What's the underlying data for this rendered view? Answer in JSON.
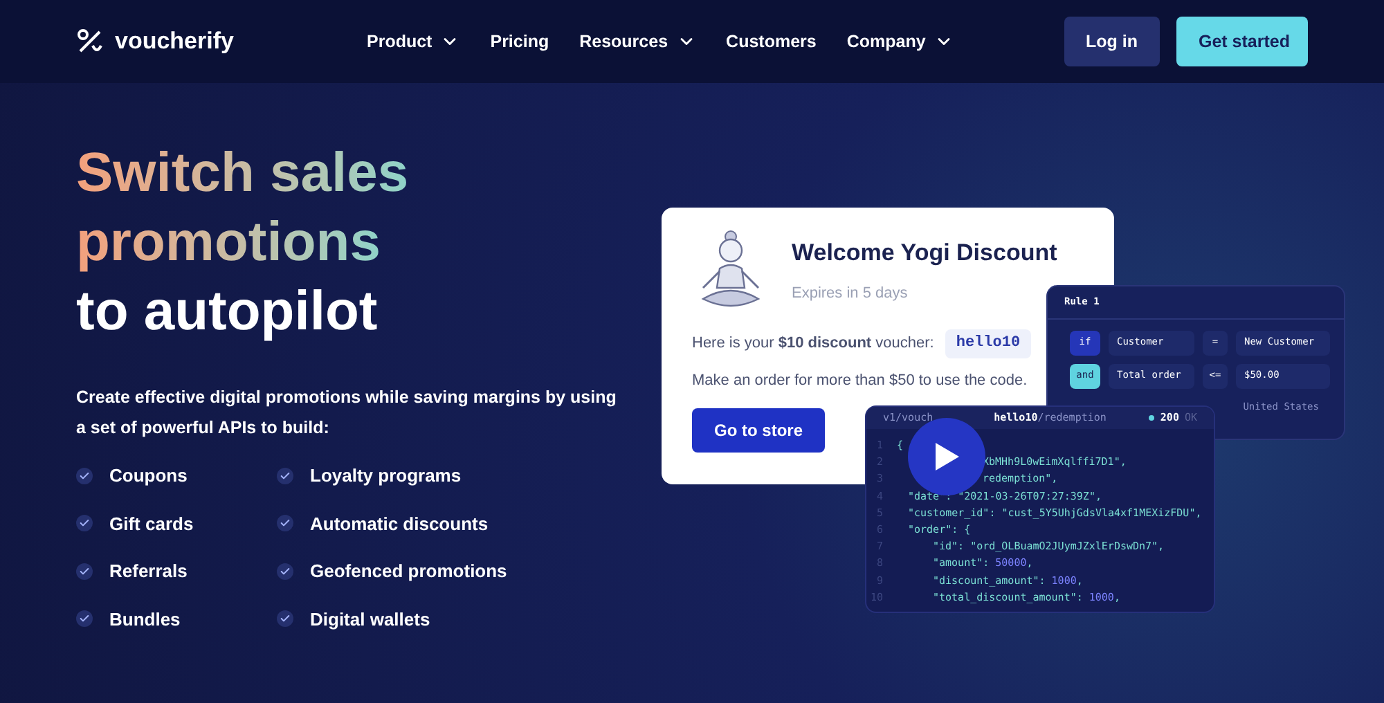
{
  "nav": {
    "logo": "voucherify",
    "links": [
      {
        "label": "Product",
        "dropdown": true
      },
      {
        "label": "Pricing",
        "dropdown": false
      },
      {
        "label": "Resources",
        "dropdown": true
      },
      {
        "label": "Customers",
        "dropdown": false
      },
      {
        "label": "Company",
        "dropdown": true
      }
    ],
    "login": "Log in",
    "cta": "Get started"
  },
  "hero": {
    "heading": [
      {
        "text": "Switch sales",
        "kind": "gradient"
      },
      {
        "text": "promotions",
        "kind": "gradient"
      },
      {
        "text": "to autopilot",
        "kind": "plain"
      }
    ],
    "intro": "Create effective digital promotions while saving margins by using a set of powerful APIs to build:",
    "features": [
      "Coupons",
      "Loyalty programs",
      "Gift cards",
      "Automatic discounts",
      "Referrals",
      "Geofenced promotions",
      "Bundles",
      "Digital wallets"
    ]
  },
  "voucher_card": {
    "title": "Welcome Yogi Discount",
    "expiry": "Expires in 5 days",
    "message": "Here is your **$10 discount** voucher:",
    "code": "hello10",
    "condition": "Make an order for more than $50 to use the code.",
    "button": "Go to store"
  },
  "rule_panel": {
    "title": "Rule 1",
    "rows": [
      {
        "kind": "if",
        "op_label": "if",
        "field": "Customer",
        "operator": "=",
        "value": "New Customer"
      },
      {
        "kind": "and",
        "op_label": "and",
        "field": "Total order",
        "operator": "<=",
        "value": "$50.00"
      }
    ],
    "extra": "United States"
  },
  "api_panel": {
    "path": [
      {
        "parts": [
          {
            "kind": "text",
            "text": "v1/vouch"
          }
        ]
      },
      {
        "parts": [
          {
            "kind": "strong",
            "text": "hello10"
          },
          {
            "kind": "text",
            "text": "/redemption"
          }
        ]
      }
    ],
    "status_code": "200",
    "status_text": "OK",
    "lines": [
      {
        "num": "1",
        "parts": [
          {
            "kind": "text",
            "text": "{"
          }
        ],
        "children": [
          {
            "num": "2",
            "parts": [
              {
                "kind": "gap"
              },
              {
                "kind": "text",
                "text": "XbMHh9L0wEimXqlffi7D1\","
              }
            ]
          },
          {
            "num": "3",
            "parts": [
              {
                "kind": "gap"
              },
              {
                "kind": "text",
                "text": "redemption\","
              }
            ]
          },
          {
            "num": "4",
            "parts": [
              {
                "kind": "text",
                "text": "\"date\": \"2021-03-26T07:27:39Z\","
              }
            ]
          },
          {
            "num": "5",
            "parts": [
              {
                "kind": "text",
                "text": "\"customer_id\": \"cust_5Y5UhjGdsVla4xf1MEXizFDU\","
              }
            ]
          },
          {
            "num": "6",
            "parts": [
              {
                "kind": "text",
                "text": "\"order\": {"
              }
            ],
            "children": [
              {
                "num": "7",
                "parts": [
                  {
                    "kind": "text",
                    "text": "\"id\": \"ord_OLBuamO2JUymJZxlErDswDn7\","
                  }
                ]
              },
              {
                "num": "8",
                "parts": [
                  {
                    "kind": "text",
                    "text": "\"amount\": "
                  },
                  {
                    "kind": "number",
                    "text": "50000"
                  },
                  {
                    "kind": "text",
                    "text": ","
                  }
                ]
              },
              {
                "num": "9",
                "parts": [
                  {
                    "kind": "text",
                    "text": "\"discount_amount\": "
                  },
                  {
                    "kind": "number",
                    "text": "1000"
                  },
                  {
                    "kind": "text",
                    "text": ","
                  }
                ]
              },
              {
                "num": "10",
                "parts": [
                  {
                    "kind": "text",
                    "text": "\"total_discount_amount\": "
                  },
                  {
                    "kind": "number",
                    "text": "1000"
                  },
                  {
                    "kind": "text",
                    "text": ","
                  }
                ]
              }
            ]
          }
        ]
      }
    ]
  }
}
